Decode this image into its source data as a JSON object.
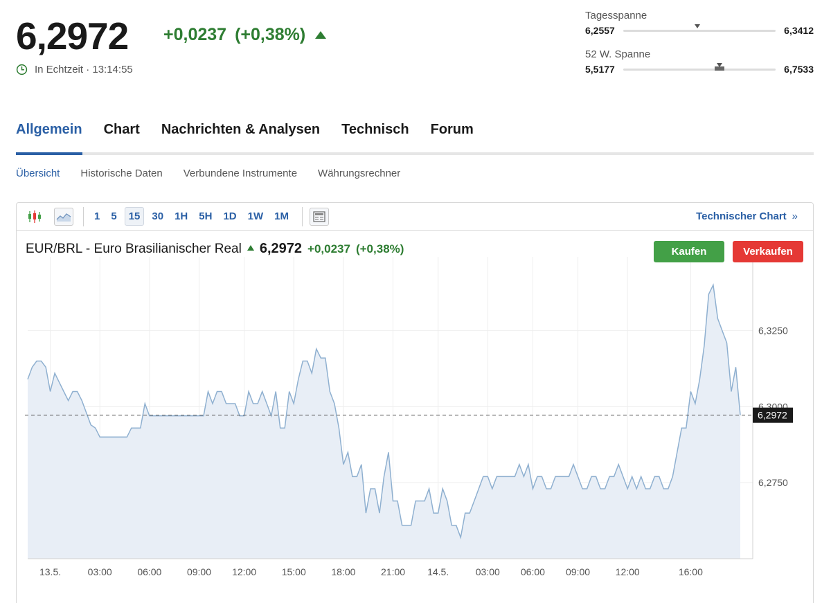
{
  "header": {
    "price": "6,2972",
    "change": "+0,0237",
    "change_pct": "(+0,38%)",
    "realtime_label": "In Echtzeit · 13:14:55"
  },
  "day_range": {
    "title": "Tagesspanne",
    "low": "6,2557",
    "high": "6,3412",
    "position": 0.485
  },
  "week52_range": {
    "title": "52 W. Spanne",
    "low": "5,5177",
    "high": "6,7533",
    "position": 0.63
  },
  "tabs": [
    {
      "label": "Allgemein",
      "active": true
    },
    {
      "label": "Chart",
      "active": false
    },
    {
      "label": "Nachrichten & Analysen",
      "active": false
    },
    {
      "label": "Technisch",
      "active": false
    },
    {
      "label": "Forum",
      "active": false
    }
  ],
  "subtabs": [
    {
      "label": "Übersicht",
      "active": true
    },
    {
      "label": "Historische Daten",
      "active": false
    },
    {
      "label": "Verbundene Instrumente",
      "active": false
    },
    {
      "label": "Währungsrechner",
      "active": false
    }
  ],
  "toolbar": {
    "timeframes": [
      "1",
      "5",
      "15",
      "30",
      "1H",
      "5H",
      "1D",
      "1W",
      "1M"
    ],
    "active_timeframe": "15",
    "tech_chart_label": "Technischer Chart",
    "tech_chart_chevron": "»"
  },
  "chart_head": {
    "instrument": "EUR/BRL - Euro Brasilianischer Real",
    "price": "6,2972",
    "change": "+0,0237",
    "change_pct": "(+0,38%)"
  },
  "buttons": {
    "buy": "Kaufen",
    "sell": "Verkaufen"
  },
  "colors": {
    "positive": "#2e7d32",
    "accent": "#2a5fa5",
    "buy": "#43a047",
    "sell": "#e53935",
    "line": "#8fb0d0",
    "area": "#e8eef6"
  },
  "chart_data": {
    "type": "area",
    "ylim": [
      6.25,
      6.347
    ],
    "y_ticks": [
      {
        "value": 6.325,
        "label": "6,3250"
      },
      {
        "value": 6.3,
        "label": "6,3000"
      },
      {
        "value": 6.275,
        "label": "6,2750"
      }
    ],
    "x_ticks": [
      {
        "index": 5,
        "label": "13.5."
      },
      {
        "index": 16,
        "label": "03:00"
      },
      {
        "index": 27,
        "label": "06:00"
      },
      {
        "index": 38,
        "label": "09:00"
      },
      {
        "index": 48,
        "label": "12:00"
      },
      {
        "index": 59,
        "label": "15:00"
      },
      {
        "index": 70,
        "label": "18:00"
      },
      {
        "index": 81,
        "label": "21:00"
      },
      {
        "index": 91,
        "label": "14.5."
      },
      {
        "index": 102,
        "label": "03:00"
      },
      {
        "index": 112,
        "label": "06:00"
      },
      {
        "index": 122,
        "label": "09:00"
      },
      {
        "index": 133,
        "label": "12:00"
      },
      {
        "index": 147,
        "label": "16:00"
      }
    ],
    "current_value": 6.2972,
    "current_label": "6,2972",
    "values": [
      6.309,
      6.313,
      6.315,
      6.315,
      6.313,
      6.305,
      6.311,
      6.308,
      6.305,
      6.302,
      6.305,
      6.305,
      6.302,
      6.298,
      6.294,
      6.293,
      6.29,
      6.29,
      6.29,
      6.29,
      6.29,
      6.29,
      6.29,
      6.293,
      6.293,
      6.293,
      6.301,
      6.297,
      6.297,
      6.297,
      6.297,
      6.297,
      6.297,
      6.297,
      6.297,
      6.297,
      6.297,
      6.297,
      6.297,
      6.297,
      6.305,
      6.301,
      6.305,
      6.305,
      6.301,
      6.301,
      6.301,
      6.297,
      6.297,
      6.305,
      6.301,
      6.301,
      6.305,
      6.301,
      6.297,
      6.305,
      6.293,
      6.293,
      6.305,
      6.301,
      6.309,
      6.315,
      6.315,
      6.311,
      6.319,
      6.316,
      6.316,
      6.305,
      6.301,
      6.293,
      6.281,
      6.285,
      6.277,
      6.277,
      6.281,
      6.265,
      6.273,
      6.273,
      6.265,
      6.277,
      6.285,
      6.269,
      6.269,
      6.261,
      6.261,
      6.261,
      6.269,
      6.269,
      6.269,
      6.273,
      6.265,
      6.265,
      6.273,
      6.269,
      6.261,
      6.261,
      6.257,
      6.265,
      6.265,
      6.269,
      6.273,
      6.277,
      6.277,
      6.273,
      6.277,
      6.277,
      6.277,
      6.277,
      6.277,
      6.281,
      6.277,
      6.281,
      6.273,
      6.277,
      6.277,
      6.273,
      6.273,
      6.277,
      6.277,
      6.277,
      6.277,
      6.281,
      6.277,
      6.273,
      6.273,
      6.277,
      6.277,
      6.273,
      6.273,
      6.277,
      6.277,
      6.281,
      6.277,
      6.273,
      6.277,
      6.273,
      6.277,
      6.273,
      6.273,
      6.277,
      6.277,
      6.273,
      6.273,
      6.277,
      6.285,
      6.293,
      6.293,
      6.305,
      6.301,
      6.309,
      6.32,
      6.337,
      6.34,
      6.329,
      6.325,
      6.321,
      6.305,
      6.313,
      6.2972
    ]
  }
}
